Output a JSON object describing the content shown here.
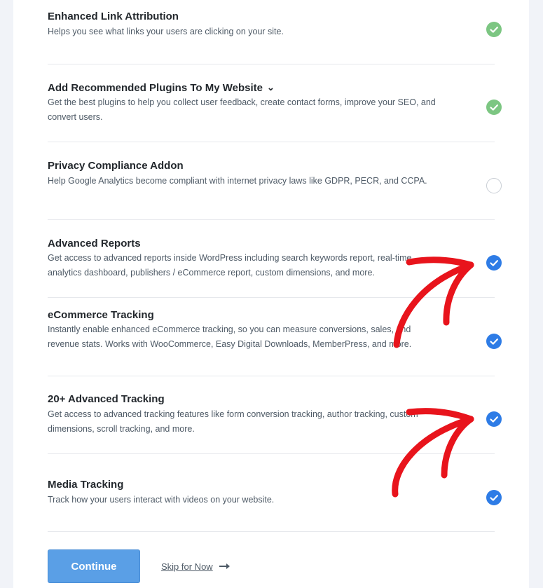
{
  "features": [
    {
      "title": "Enhanced Link Attribution",
      "description": "Helps you see what links your users are clicking on your site.",
      "status": "checked-green",
      "has_chevron": false
    },
    {
      "title": "Add Recommended Plugins To My Website",
      "description": "Get the best plugins to help you collect user feedback, create contact forms, improve your SEO, and convert users.",
      "status": "checked-green",
      "has_chevron": true
    },
    {
      "title": "Privacy Compliance Addon",
      "description": "Help Google Analytics become compliant with internet privacy laws like GDPR, PECR, and CCPA.",
      "status": "unchecked",
      "has_chevron": false
    },
    {
      "title": "Advanced Reports",
      "description": "Get access to advanced reports inside WordPress including search keywords report, real-time analytics dashboard, publishers / eCommerce report, custom dimensions, and more.",
      "status": "checked-blue",
      "has_chevron": false
    },
    {
      "title": "eCommerce Tracking",
      "description": "Instantly enable enhanced eCommerce tracking, so you can measure conversions, sales, and revenue stats. Works with WooCommerce, Easy Digital Downloads, MemberPress, and more.",
      "status": "checked-blue",
      "has_chevron": false
    },
    {
      "title": "20+ Advanced Tracking",
      "description": "Get access to advanced tracking features like form conversion tracking, author tracking, custom dimensions, scroll tracking, and more.",
      "status": "checked-blue",
      "has_chevron": false
    },
    {
      "title": "Media Tracking",
      "description": "Track how your users interact with videos on your website.",
      "status": "checked-blue",
      "has_chevron": false
    }
  ],
  "actions": {
    "continue_label": "Continue",
    "skip_label": "Skip for Now"
  },
  "colors": {
    "check_green": "#7cc682",
    "check_blue": "#2e7ce6",
    "continue_button": "#5a9fe6",
    "annotation_red": "#e8141c"
  },
  "icons": {
    "chevron": "chevron-down-icon",
    "check": "checkmark-icon",
    "skip_arrow": "arrow-right-icon",
    "annotation": "red-arrow-annotation"
  }
}
